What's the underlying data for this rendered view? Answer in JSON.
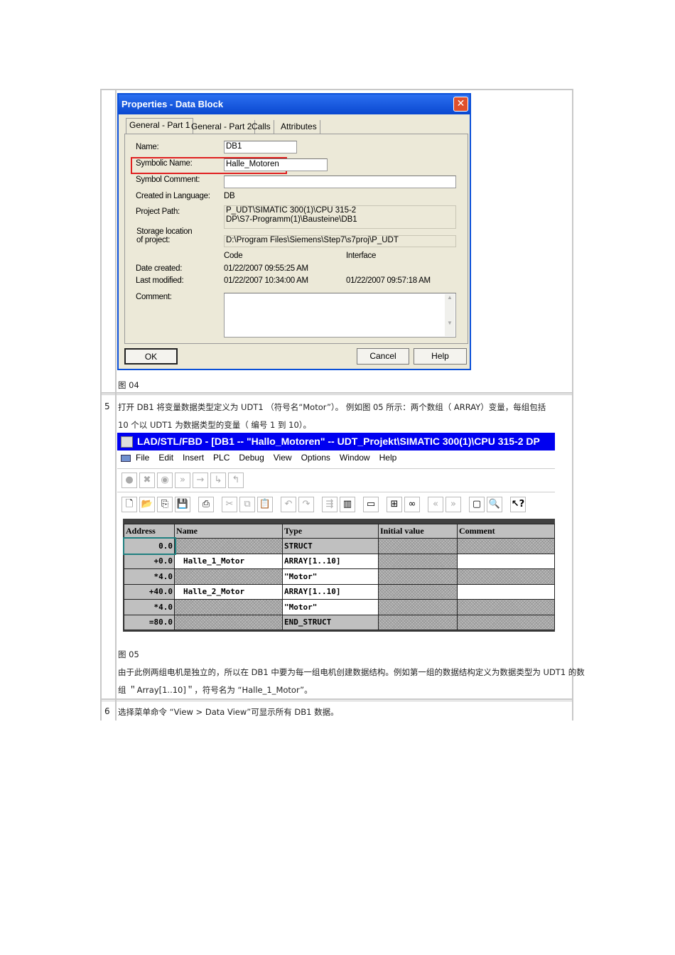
{
  "dialog": {
    "title": "Properties - Data Block",
    "tabs": [
      "General - Part 1",
      "General - Part 2",
      "Calls",
      "Attributes"
    ],
    "name_label": "Name:",
    "name_value": "DB1",
    "symbolic_label": "Symbolic Name:",
    "symbolic_value": "Halle_Motoren",
    "symbol_comment_label": "Symbol Comment:",
    "language_label": "Created in Language:",
    "language_value": "DB",
    "project_path_label": "Project Path:",
    "project_path_line1": "P_UDT\\SIMATIC 300(1)\\CPU 315-2",
    "project_path_line2": "DP\\S7-Programm(1)\\Bausteine\\DB1",
    "storage_label_1": "Storage location",
    "storage_label_2": "of project:",
    "storage_value": "D:\\Program Files\\Siemens\\Step7\\s7proj\\P_UDT",
    "code_header": "Code",
    "interface_header": "Interface",
    "date_created_label": "Date created:",
    "date_created_code": "01/22/2007 09:55:25 AM",
    "last_modified_label": "Last modified:",
    "last_modified_code": "01/22/2007 10:34:00 AM",
    "last_modified_interface": "01/22/2007 09:57:18 AM",
    "comment_label": "Comment:",
    "ok": "OK",
    "cancel": "Cancel",
    "help": "Help"
  },
  "fig04": "图 04",
  "step5": {
    "num": "5",
    "line1": "打开 DB1 将变量数据类型定义为 UDT1 （符号名“Motor”）。 例如图 05 所示：两个数组（ ARRAY）变量，每组包括",
    "line2": "10 个以 UDT1 为数据类型的变量（ 编号 1 到 10）。"
  },
  "lad": {
    "title": "LAD/STL/FBD  - [DB1 -- \"Hallo_Motoren\" -- UDT_Projekt\\SIMATIC 300(1)\\CPU 315-2 DP",
    "menu": [
      "File",
      "Edit",
      "Insert",
      "PLC",
      "Debug",
      "View",
      "Options",
      "Window",
      "Help"
    ],
    "columns": [
      "Address",
      "Name",
      "Type",
      "Initial value",
      "Comment"
    ],
    "rows": [
      [
        "0.0",
        "",
        "STRUCT"
      ],
      [
        "+0.0",
        "Halle_1_Motor",
        "ARRAY[1..10]"
      ],
      [
        "*4.0",
        "",
        "\"Motor\""
      ],
      [
        "+40.0",
        "Halle_2_Motor",
        "ARRAY[1..10]"
      ],
      [
        "*4.0",
        "",
        "\"Motor\""
      ],
      [
        "=80.0",
        "",
        "END_STRUCT"
      ]
    ]
  },
  "fig05": "图 05",
  "para1": "由于此例两组电机是独立的，所以在 DB1 中要为每一组电机创建数据结构。例如第一组的数据结构定义为数据类型为 UDT1 的数",
  "para2": "组 ＂Array[1..10]＂，符号名为 “Halle_1_Motor”。",
  "step6": {
    "num": "6",
    "text": "选择菜单命令 “View > Data View”可显示所有 DB1 数据。"
  }
}
